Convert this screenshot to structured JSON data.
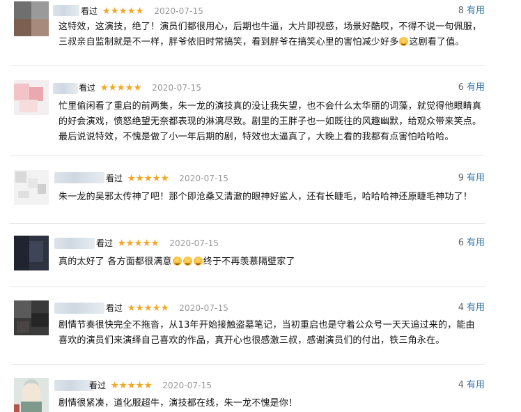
{
  "reviews": [
    {
      "watched_label": "看过",
      "date": "2020-07-15",
      "useful_count": "8",
      "useful_label": "有用",
      "rating_stars": 5,
      "content": [
        "这特效，这演技，绝了！演员们都很用心，后期也牛逼，大片即视感，场景好酷哎，不得不说一句佩服，三叔亲自监制就是不一样，胖爷依旧时常搞笑，看到胖爷在搞笑心里的害怕减少好多",
        "这剧看了值。"
      ],
      "emojis": [
        "laughing-crying-emoji"
      ]
    },
    {
      "watched_label": "看过",
      "date": "2020-07-15",
      "useful_count": "6",
      "useful_label": "有用",
      "rating_stars": 5,
      "content": [
        "忙里偷闲看了重启的前两集，朱一龙的演技真的没让我失望，也不会什么太华丽的词藻，就觉得他眼睛真的好会演戏，愤怒绝望无奈都表现的淋漓尽致。剧里的王胖子也一如既往的风趣幽默，给观众带来笑点。最后说说特效，不愧是做了小一年后期的剧，特效也太逼真了，大晚上看的我都有点害怕哈哈哈。"
      ],
      "emojis": []
    },
    {
      "watched_label": "看过",
      "date": "2020-07-15",
      "useful_count": "9",
      "useful_label": "有用",
      "rating_stars": 5,
      "content": [
        "朱一龙的吴邪太传神了吧！那个即沧桑又清澈的眼神好鲨人，还有长睫毛，哈哈哈神还原睫毛神功了！"
      ],
      "emojis": []
    },
    {
      "watched_label": "看过",
      "date": "2020-07-15",
      "useful_count": "6",
      "useful_label": "有用",
      "rating_stars": 5,
      "content": [
        "真的太好了 各方面都很满意",
        "终于不再羡慕隔壁家了"
      ],
      "emojis": [
        "crying-emoji",
        "crying-emoji",
        "crying-emoji"
      ]
    },
    {
      "watched_label": "看过",
      "date": "2020-07-15",
      "useful_count": "4",
      "useful_label": "有用",
      "rating_stars": 5,
      "content": [
        "剧情节奏很快完全不拖沓，从13年开始接触盗墓笔记，当初重启也是守着公众号一天天追过来的，能由喜欢的演员们来演绎自己喜欢的作品，真开心也很感激三叔，感谢演员们的付出，铁三角永在。"
      ],
      "emojis": []
    },
    {
      "watched_label": "看过",
      "date": "2020-07-15",
      "useful_count": "4",
      "useful_label": "有用",
      "rating_stars": 5,
      "content": [
        "剧情很紧凑，道化服超牛，演技都在线，朱一龙不愧是你！"
      ],
      "emojis": []
    }
  ],
  "colors": {
    "star": "#f5a623",
    "useful_link": "#3377aa",
    "date": "#999999",
    "divider": "#e6e6e6"
  }
}
